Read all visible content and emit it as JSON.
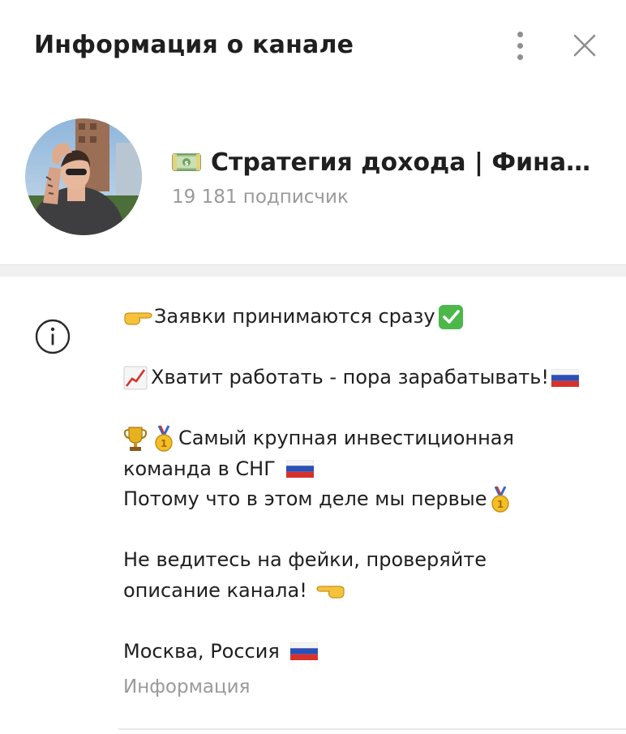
{
  "header": {
    "title": "Информация о канале",
    "menu_icon": "more-vertical-icon",
    "close_icon": "close-icon"
  },
  "channel": {
    "name": "Стратегия дохода | Финанс...",
    "name_icon": "money-banknote-icon",
    "subscribers": "19 181 подписчик"
  },
  "description": {
    "line1": "Заявки принимаются сразу",
    "line2": "Хватит работать - пора зарабатывать!",
    "line3": "Самый крупная инвестиционная",
    "line4": "команда в СНГ",
    "line5": "Потому что в этом деле мы первые",
    "line6": "Не ведитесь на фейки, проверяйте",
    "line7": "описание канала!",
    "line8": "Москва, Россия",
    "label": "Информация"
  },
  "colors": {
    "text": "#1f1f1f",
    "secondary_text": "#9a9a9a",
    "icon_gray": "#8f8f8f",
    "separator": "#f0f0f0"
  }
}
